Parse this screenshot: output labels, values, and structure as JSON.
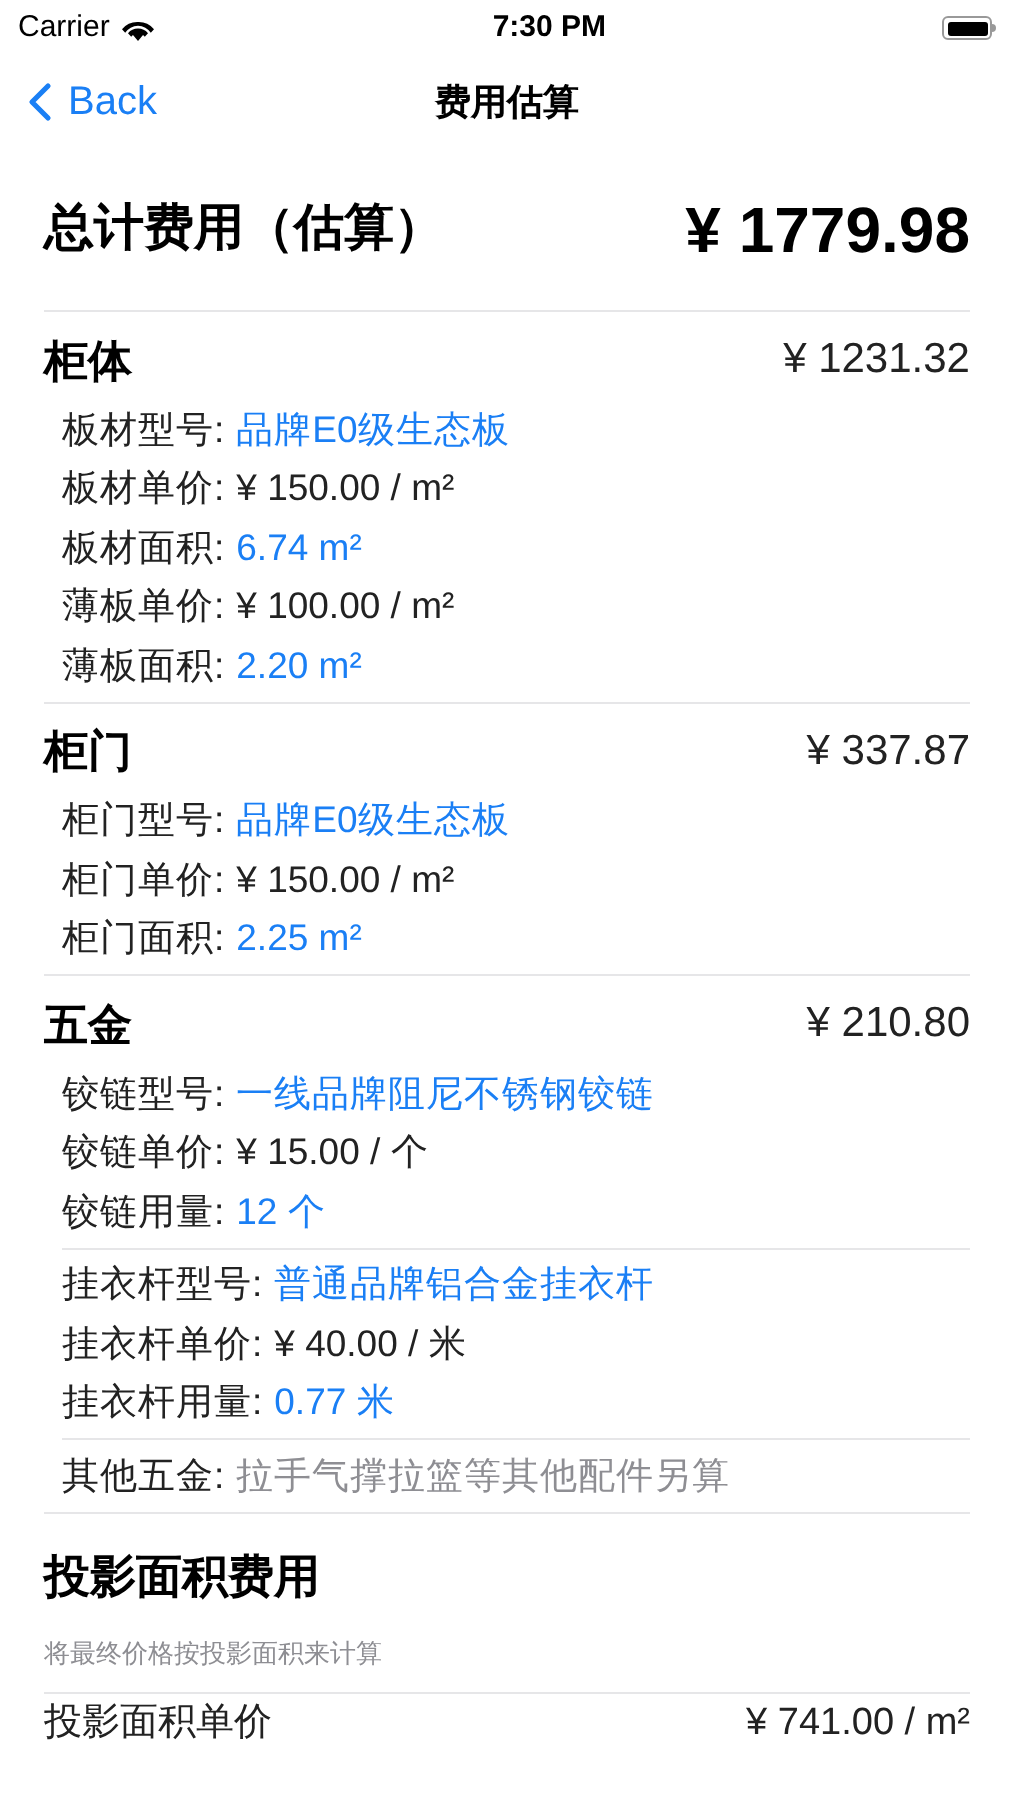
{
  "status_bar": {
    "carrier": "Carrier",
    "time": "7:30 PM"
  },
  "nav": {
    "back": "Back",
    "title": "费用估算"
  },
  "total": {
    "label": "总计费用（估算）",
    "amount": "¥ 1779.98"
  },
  "sections": [
    {
      "title": "柜体",
      "amount": "¥ 1231.32",
      "groups": [
        {
          "rows": [
            {
              "label": "板材型号:",
              "value": "品牌E0级生态板",
              "kind": "highlight"
            },
            {
              "label": "板材单价:",
              "value": "¥ 150.00 / m²",
              "kind": "plain"
            },
            {
              "label": "板材面积:",
              "value": "6.74 m²",
              "kind": "highlight"
            },
            {
              "label": "薄板单价:",
              "value": "¥ 100.00 / m²",
              "kind": "plain"
            },
            {
              "label": "薄板面积:",
              "value": "2.20 m²",
              "kind": "highlight"
            }
          ]
        }
      ]
    },
    {
      "title": "柜门",
      "amount": "¥ 337.87",
      "groups": [
        {
          "rows": [
            {
              "label": "柜门型号:",
              "value": "品牌E0级生态板",
              "kind": "highlight"
            },
            {
              "label": "柜门单价:",
              "value": "¥ 150.00 / m²",
              "kind": "plain"
            },
            {
              "label": "柜门面积:",
              "value": "2.25 m²",
              "kind": "highlight"
            }
          ]
        }
      ]
    },
    {
      "title": "五金",
      "amount": "¥ 210.80",
      "groups": [
        {
          "rows": [
            {
              "label": "铰链型号:",
              "value": "一线品牌阻尼不锈钢铰链",
              "kind": "highlight"
            },
            {
              "label": "铰链单价:",
              "value": "¥ 15.00 / 个",
              "kind": "plain"
            },
            {
              "label": "铰链用量:",
              "value": "12 个",
              "kind": "highlight"
            }
          ]
        },
        {
          "rows": [
            {
              "label": "挂衣杆型号:",
              "value": "普通品牌铝合金挂衣杆",
              "kind": "highlight"
            },
            {
              "label": "挂衣杆单价:",
              "value": "¥ 40.00 / 米",
              "kind": "plain"
            },
            {
              "label": "挂衣杆用量:",
              "value": "0.77 米",
              "kind": "highlight"
            }
          ]
        },
        {
          "rows": [
            {
              "label": "其他五金:",
              "value": "拉手气撑拉篮等其他配件另算",
              "kind": "muted"
            }
          ]
        }
      ]
    }
  ],
  "projection": {
    "title": "投影面积费用",
    "note": "将最终价格按投影面积来计算",
    "row": {
      "label": "投影面积单价",
      "value": "¥ 741.00 / m²"
    }
  }
}
